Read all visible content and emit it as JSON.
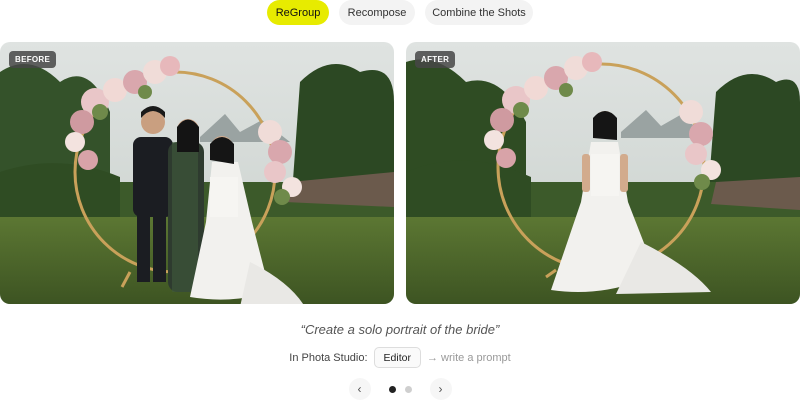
{
  "tabs": [
    {
      "label": "ReGroup",
      "active": true
    },
    {
      "label": "Recompose",
      "active": false
    },
    {
      "label": "Combine the Shots",
      "active": false
    }
  ],
  "photos": {
    "before": {
      "label": "BEFORE"
    },
    "after": {
      "label": "AFTER"
    }
  },
  "prompt": {
    "quote": "“Create a solo portrait of the bride”",
    "prefix": "In Phota Studio:",
    "chip": "Editor",
    "suffix": "→ write a prompt"
  },
  "carousel": {
    "prev_icon": "chevron-left-icon",
    "next_icon": "chevron-right-icon",
    "prev_glyph": "‹",
    "next_glyph": "›",
    "dots_count": 2,
    "active_dot": 1
  },
  "colors": {
    "accent": "#e7eb00",
    "grass": "#4f6a2c",
    "sky": "#d9dfdc"
  }
}
